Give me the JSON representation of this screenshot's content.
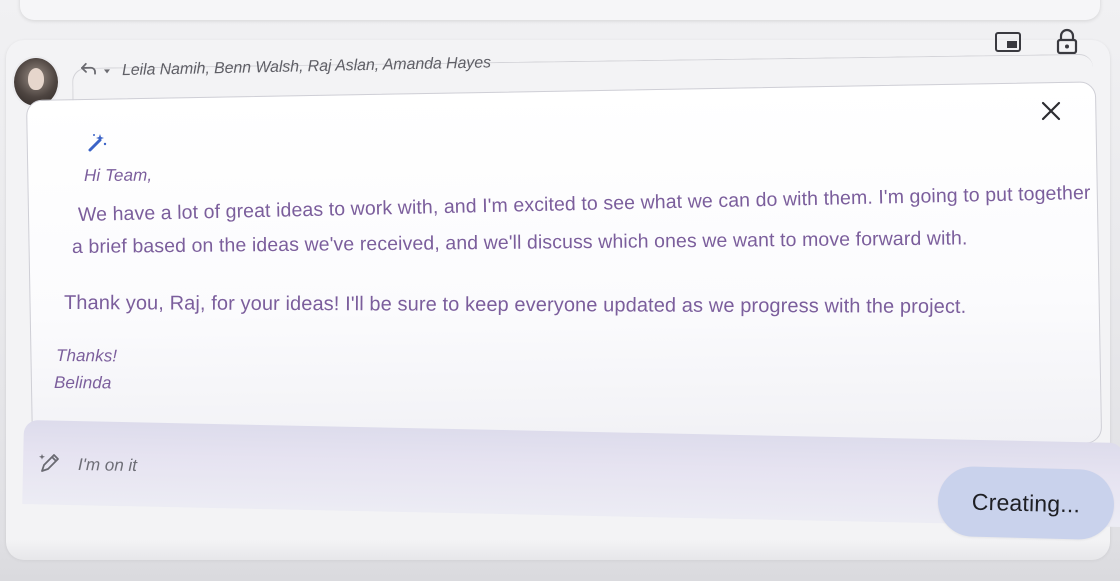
{
  "header": {
    "recipients": "Leila Namih, Benn Walsh, Raj Aslan, Amanda Hayes"
  },
  "icons": {
    "reply": "reply-icon",
    "reply_menu": "chevron-down-icon",
    "pip": "picture-in-picture-icon",
    "lock": "lock-icon",
    "close": "close-icon",
    "magic_wand": "magic-wand-icon",
    "pencil": "pencil-sparkle-icon"
  },
  "draft": {
    "greeting": "Hi Team,",
    "paragraph1_line1": "We have a lot of great ideas to work with, and I'm excited to see what we can do with them. I'm going to put together",
    "paragraph1_line2": "a brief based on the ideas we've received, and we'll discuss which ones we want to move forward with.",
    "paragraph2": "Thank you, Raj, for your ideas! I'll be sure to keep everyone updated as we progress with the project.",
    "closing": "Thanks!",
    "signature": "Belinda"
  },
  "prompt": {
    "value": "I'm on it"
  },
  "status_button": {
    "label": "Creating..."
  },
  "colors": {
    "draft_text": "#7b5e9c",
    "wand_accent": "#3b63c7",
    "creating_button_bg": "#c9d2ec",
    "prompt_bar_bg": "#e3e1ef"
  }
}
